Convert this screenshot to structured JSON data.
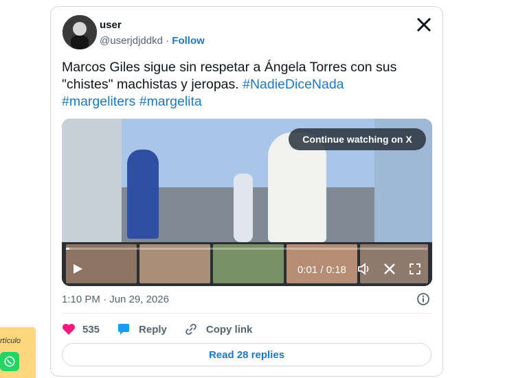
{
  "side_card": {
    "label": "rtículo",
    "icon": "whatsapp-icon"
  },
  "tweet": {
    "username": "user",
    "handle": "@userjdjddkd",
    "separator": " · ",
    "follow_label": "Follow",
    "text_plain": "Marcos Giles sigue sin respetar a Ángela Torres con sus \"chistes\" machistas y jeropas. ",
    "hashtags": [
      "#NadieDiceNada",
      "#margeliters",
      "#margelita"
    ],
    "timestamp": "1:10 PM · Jun 29, 2026",
    "likes": "535",
    "reply_label": "Reply",
    "copy_link_label": "Copy link",
    "read_replies_label": "Read 28 replies"
  },
  "video": {
    "continue_label": "Continue watching on X",
    "time": "0:01 / 0:18",
    "progress": 0.01
  },
  "colors": {
    "link": "#1d77c4",
    "like": "#f91880",
    "reply": "#1d9bf0"
  }
}
